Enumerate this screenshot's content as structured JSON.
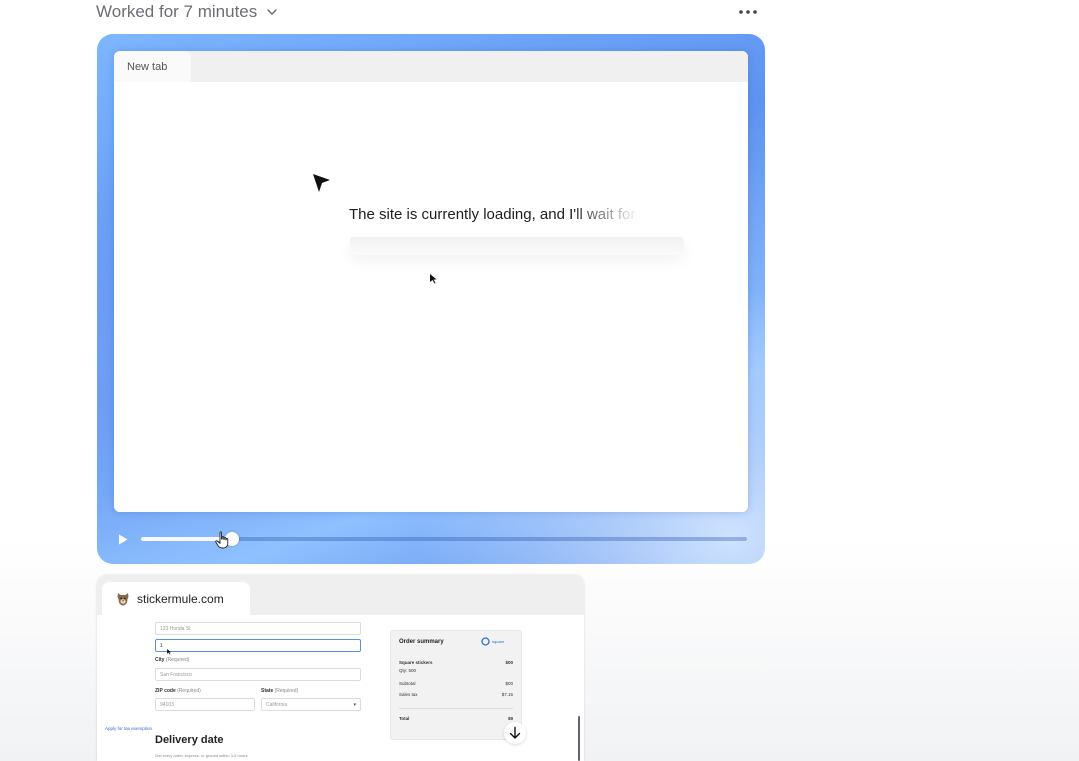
{
  "header": {
    "worked_label": "Worked for 7 minutes"
  },
  "player": {
    "tab_label": "New tab",
    "loading_text": "The site is currently loading, and I'll wait for",
    "progress": 0.15
  },
  "thumbnail": {
    "tab_label": "stickermule.com",
    "address_value": "123 Honda St",
    "address2_value": "1",
    "city_label": "City",
    "city_required": "(Required)",
    "city_value": "San Francisco",
    "zip_label": "ZIP code",
    "zip_required": "(Required)",
    "zip_value": "94103",
    "state_label": "State",
    "state_required": "(Required)",
    "state_value": "California",
    "delivery_title": "Delivery date",
    "delivery_sub": "Get every order, express, or ground within 3-5 hours",
    "summary": {
      "title": "Order summary",
      "logo_text": "square",
      "item_name": "Square stickers",
      "item_qty": "Qty: 500",
      "item_price": "$00",
      "subtotal_label": "Subtotal",
      "subtotal_value": "$00",
      "tax_label": "Sales tax",
      "tax_value": "$7.15",
      "total_label": "Total",
      "total_value": "$9",
      "exemption_link": "Apply for tax exemption"
    }
  },
  "icons": {
    "chevron": "chevron-down-icon",
    "more": "more-horizontal-icon",
    "play": "play-icon",
    "scroll_down": "arrow-down-icon"
  }
}
